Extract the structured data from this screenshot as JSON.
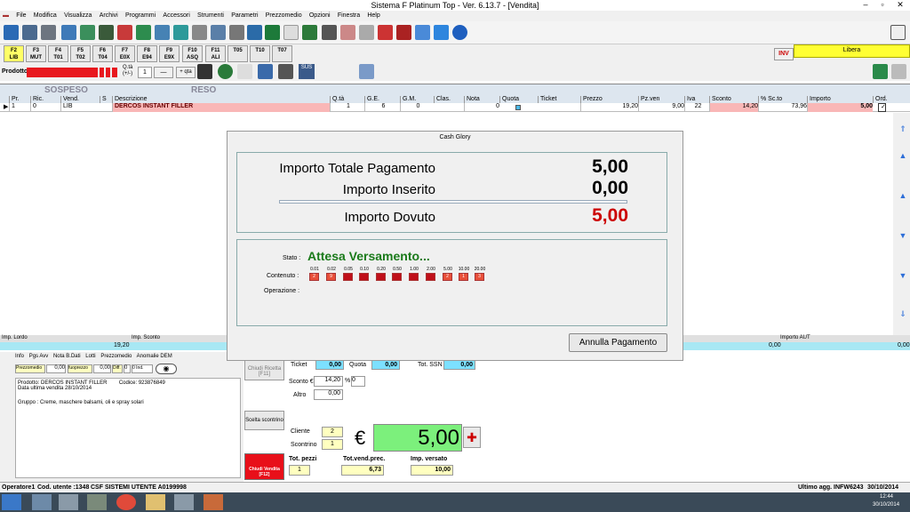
{
  "window": {
    "title": "Sistema F Platinum Top - Ver. 6.13.7 - [Vendita]"
  },
  "menu": [
    "File",
    "Modifica",
    "Visualizza",
    "Archivi",
    "Programmi",
    "Accessori",
    "Strumenti",
    "Parametri",
    "Prezzomedio",
    "Opzioni",
    "Finestra",
    "Help"
  ],
  "fkeys": [
    [
      "F2",
      "LIB"
    ],
    [
      "F3",
      "MUT"
    ],
    [
      "F4",
      "T01"
    ],
    [
      "F5",
      "T02"
    ],
    [
      "F6",
      "T04"
    ],
    [
      "F7",
      "E0X"
    ],
    [
      "F8",
      "E94"
    ],
    [
      "F9",
      "E9X"
    ],
    [
      "F10",
      "ASQ"
    ],
    [
      "F11",
      "ALI"
    ],
    [
      "",
      "T05"
    ],
    [
      "",
      "T10"
    ],
    [
      "",
      "T07"
    ]
  ],
  "inv_label": "INV",
  "status_libera": "Libera",
  "row3": {
    "prodotto": "Prodotto",
    "qta_label": "Q.tà (+/-)",
    "qta": "1",
    "minus": "—",
    "plus_qta": "+ qta",
    "sus": "SUS"
  },
  "grid": {
    "sospeso": "SOSPESO",
    "reso": "RESO",
    "headers": [
      "Pr.",
      "Ric.",
      "Vend.",
      "S",
      "Descrizione",
      "Q.tà",
      "G.E.",
      "G.M.",
      "Clas.",
      "Nota",
      "Quota",
      "Ticket",
      "Prezzo",
      "Pz.ven",
      "Iva",
      "Sconto",
      "% Sc.to",
      "Importo",
      "Ord."
    ],
    "row": {
      "pr": "1",
      "ric": "0",
      "vend": "LIB",
      "desc": "DERCOS INSTANT FILLER",
      "qta": "1",
      "ge": "6",
      "gm": "0",
      "nota": "0",
      "prezzo": "19,20",
      "pzven": "9,00",
      "iva": "22",
      "sconto": "14,20",
      "scperc": "73,96",
      "importo": "5,00"
    }
  },
  "dialog": {
    "title": "Cash Glory",
    "tot_label": "Importo Totale Pagamento",
    "tot": "5,00",
    "ins_label": "Importo Inserito",
    "ins": "0,00",
    "dov_label": "Importo Dovuto",
    "dov": "5,00",
    "stato_label": "Stato :",
    "stato": "Attesa Versamento...",
    "contenuto_label": "Contenuto :",
    "operazione_label": "Operazione :",
    "denoms": [
      "0.01",
      "0.02",
      "0.05",
      "0.10",
      "0.20",
      "0.50",
      "1.00",
      "2.00",
      "5.00",
      "10.00",
      "20.00"
    ],
    "counts": [
      "2",
      "9",
      "",
      "",
      "",
      "",
      "",
      "",
      "2",
      "1",
      "3"
    ],
    "cancel": "Annulla Pagamento"
  },
  "summary": {
    "imp_lordo": "Imp. Lordo",
    "imp_sconto": "Imp. Sconto",
    "imp_aut": "Importo AUT",
    "lordo_val": "19,20",
    "v1": "0,00",
    "v2": "0,00",
    "v3": "0,00"
  },
  "tabs": [
    "Info",
    "Pgs Avv",
    "Nota B.Dati",
    "Lotti",
    "Prezzomedio",
    "Anomalie DEM"
  ],
  "info": {
    "prezzomedio": "Prezzomedio",
    "pm": "0,00",
    "fuoriprezzo": "fuoprezzo",
    "fp": "0,00",
    "diff": "Diff.",
    "d": "0",
    "ind": "0 Ind.",
    "prod": "Prodotto: DERCOS INSTANT FILLER",
    "codice": "Codice: 923876849",
    "data": "Data ultima vendita 28/10/2014",
    "gruppo": "Gruppo : Creme, maschere balsami, oli e spray solari"
  },
  "bottom": {
    "chiudi_ricetta": "Chiudi Ricetta [F11]",
    "scelta": "Scelta scontrino",
    "chiudi_vendita": "Chiudi Vendita [F12]",
    "ticket": "Ticket",
    "ticket_v": "0,00",
    "quota": "Quota",
    "quota_v": "0,00",
    "tot_ssn": "Tot. SSN",
    "ssn_v": "0,00",
    "sconto_e": "Sconto €",
    "sconto_v": "14,20",
    "perc": "%",
    "perc_v": "0",
    "altro": "Altro",
    "altro_v": "0,00",
    "cliente": "Cliente",
    "cliente_v": "2",
    "scontrino": "Scontrino",
    "scontrino_v": "1",
    "euro": "€",
    "totale": "5,00",
    "tot_pezzi": "Tot. pezzi",
    "tot_pezzi_v": "1",
    "tot_vend": "Tot.vend.prec.",
    "tot_vend_v": "6,73",
    "imp_versato": "Imp. versato",
    "imp_versato_v": "10,00"
  },
  "status": {
    "operatore": "Operatore1",
    "codute": "Cod. utente :1348",
    "csf": "CSF SISTEMI UTENTE A0199998",
    "ultimo": "Ultimo agg. INFW6243",
    "data": "30/10/2014"
  },
  "clock": {
    "time": "12:44",
    "date": "30/10/2014"
  }
}
